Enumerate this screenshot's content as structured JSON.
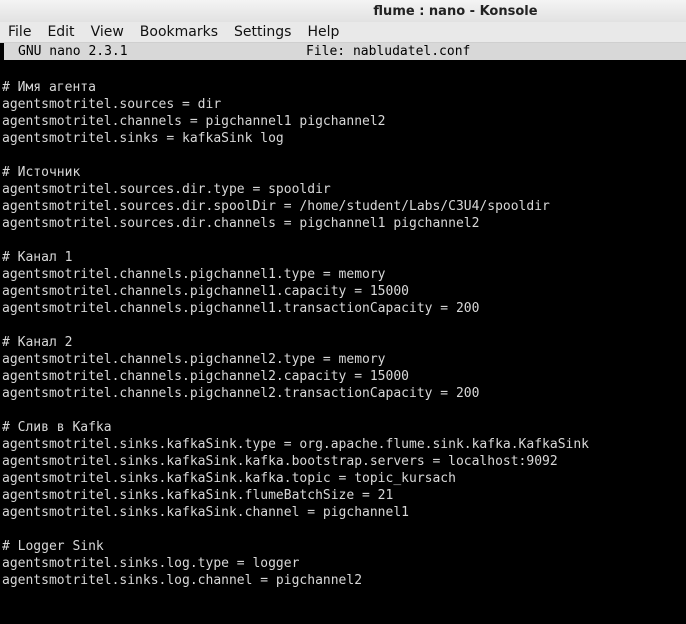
{
  "window": {
    "title": "flume : nano - Konsole"
  },
  "menu": [
    {
      "label": "File"
    },
    {
      "label": "Edit"
    },
    {
      "label": "View"
    },
    {
      "label": "Bookmarks"
    },
    {
      "label": "Settings"
    },
    {
      "label": "Help"
    }
  ],
  "nano": {
    "version": "GNU nano 2.3.1",
    "file": "File: nabludatel.conf"
  },
  "lines": [
    "# Имя агента",
    "agentsmotritel.sources = dir",
    "agentsmotritel.channels = pigchannel1 pigchannel2",
    "agentsmotritel.sinks = kafkaSink log",
    "",
    "# Источник",
    "agentsmotritel.sources.dir.type = spooldir",
    "agentsmotritel.sources.dir.spoolDir = /home/student/Labs/C3U4/spooldir",
    "agentsmotritel.sources.dir.channels = pigchannel1 pigchannel2",
    "",
    "# Канал 1",
    "agentsmotritel.channels.pigchannel1.type = memory",
    "agentsmotritel.channels.pigchannel1.capacity = 15000",
    "agentsmotritel.channels.pigchannel1.transactionCapacity = 200",
    "",
    "# Канал 2",
    "agentsmotritel.channels.pigchannel2.type = memory",
    "agentsmotritel.channels.pigchannel2.capacity = 15000",
    "agentsmotritel.channels.pigchannel2.transactionCapacity = 200",
    "",
    "# Слив в Kafka",
    "agentsmotritel.sinks.kafkaSink.type = org.apache.flume.sink.kafka.KafkaSink",
    "agentsmotritel.sinks.kafkaSink.kafka.bootstrap.servers = localhost:9092",
    "agentsmotritel.sinks.kafkaSink.kafka.topic = topic_kursach",
    "agentsmotritel.sinks.kafkaSink.flumeBatchSize = 21",
    "agentsmotritel.sinks.kafkaSink.channel = pigchannel1",
    "",
    "# Logger Sink",
    "agentsmotritel.sinks.log.type = logger",
    "agentsmotritel.sinks.log.channel = pigchannel2"
  ]
}
